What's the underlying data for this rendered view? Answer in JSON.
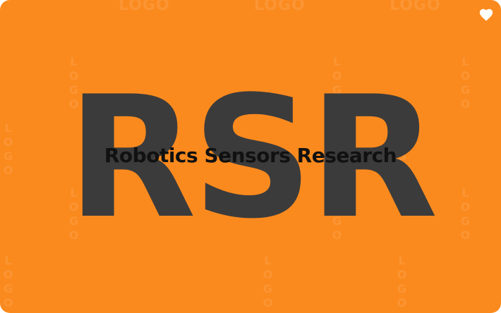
{
  "logo": {
    "monogram": "RSR",
    "name": "Robotics Sensors Research",
    "background_color": "#fb8a1e",
    "monogram_color": "#3b3b3b",
    "name_color": "#111111"
  },
  "watermark": {
    "text": "LOGO"
  },
  "actions": {
    "favorite_icon": "heart-icon",
    "favorite_color": "#ffffff"
  }
}
